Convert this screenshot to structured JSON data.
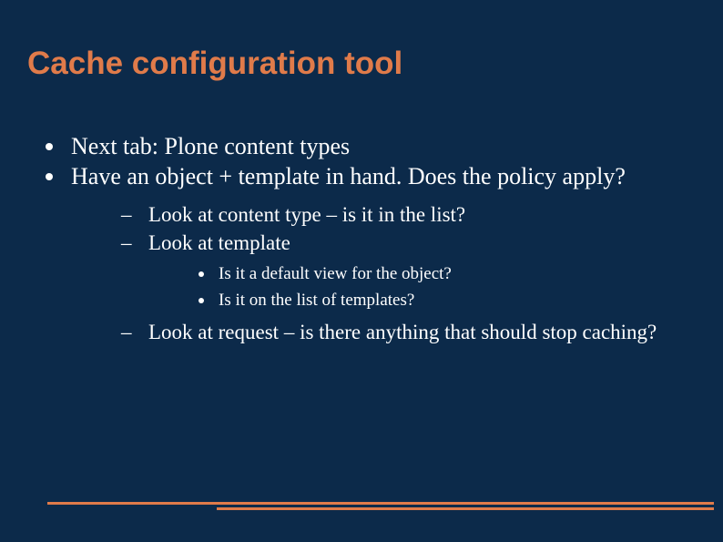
{
  "title": "Cache configuration tool",
  "bullets": {
    "l1": [
      "Next tab: Plone content types",
      "Have an object + template in hand. Does the policy apply?"
    ],
    "l2a": [
      "Look at content type – is it in the list?",
      "Look at template"
    ],
    "l3": [
      "Is it a default view for the object?",
      "Is it on the list of templates?"
    ],
    "l2b": [
      "Look at request – is there anything that should stop caching?"
    ]
  }
}
